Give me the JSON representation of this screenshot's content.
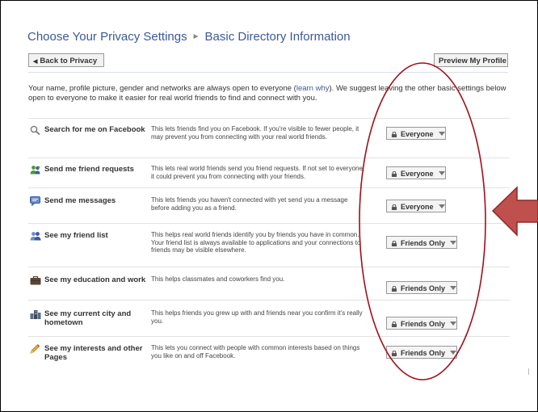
{
  "header": {
    "title": "Choose Your Privacy Settings",
    "subtitle": "Basic Directory Information",
    "back_label": "Back to Privacy",
    "preview_label": "Preview My Profile"
  },
  "intro": {
    "text_before": "Your name, profile picture, gender and networks are always open to everyone (",
    "link": "learn why",
    "text_after": "). We suggest leaving the other basic settings below open to everyone to make it easier for real world friends to find and connect with you."
  },
  "settings": [
    {
      "label": "Search for me on Facebook",
      "description": "This lets friends find you on Facebook. If you're visible to fewer people, it may prevent you from connecting with your real world friends.",
      "value": "Everyone",
      "icon": "search-icon"
    },
    {
      "label": "Send me friend requests",
      "description": "This lets real world friends send you friend requests. If not set to everyone, it could prevent you from connecting with your friends.",
      "value": "Everyone",
      "icon": "friend-request-icon"
    },
    {
      "label": "Send me messages",
      "description": "This lets friends you haven't connected with yet send you a message before adding you as a friend.",
      "value": "Everyone",
      "icon": "message-icon"
    },
    {
      "label": "See my friend list",
      "description": "This helps real world friends identify you by friends you have in common. Your friend list is always available to applications and your connections to friends may be visible elsewhere.",
      "value": "Friends Only",
      "icon": "friends-icon"
    },
    {
      "label": "See my education and work",
      "description": "This helps classmates and coworkers find you.",
      "value": "Friends Only",
      "icon": "briefcase-icon"
    },
    {
      "label": "See my current city and hometown",
      "description": "This helps friends you grew up with and friends near you confirm it's really you.",
      "value": "Friends Only",
      "icon": "city-icon"
    },
    {
      "label": "See my interests and other Pages",
      "description": "This lets you connect with people with common interests based on things you like on and off Facebook.",
      "value": "Friends Only",
      "icon": "pencil-icon"
    }
  ],
  "annotation": {
    "ellipse_color": "#a0101a",
    "arrow_fill": "#c0504d",
    "arrow_stroke": "#8b2a28"
  }
}
